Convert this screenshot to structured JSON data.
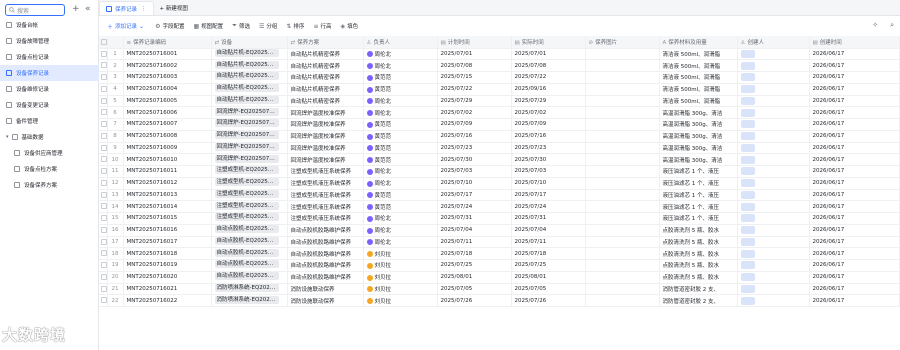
{
  "sidebar": {
    "search_placeholder": "搜索",
    "items": [
      {
        "label": "设备台帐",
        "active": false,
        "type": "page"
      },
      {
        "label": "设备故障管理",
        "active": false,
        "type": "page"
      },
      {
        "label": "设备点检记录",
        "active": false,
        "type": "page"
      },
      {
        "label": "设备保养记录",
        "active": true,
        "type": "page"
      },
      {
        "label": "设备维修记录",
        "active": false,
        "type": "page"
      },
      {
        "label": "设备变更记录",
        "active": false,
        "type": "page"
      },
      {
        "label": "备件管理",
        "active": false,
        "type": "page"
      },
      {
        "label": "基础数据",
        "active": false,
        "type": "folder"
      },
      {
        "label": "设备供应商管理",
        "active": false,
        "type": "sub"
      },
      {
        "label": "设备点检方案",
        "active": false,
        "type": "sub"
      },
      {
        "label": "设备保养方案",
        "active": false,
        "type": "sub"
      }
    ]
  },
  "tabs": {
    "active": "保养记录",
    "new": "+ 新建视图"
  },
  "toolbar": {
    "add": "添加记录",
    "fields": "字段配置",
    "view": "视图配置",
    "filter": "筛选",
    "group": "分组",
    "sort": "排序",
    "rowheight": "行高",
    "color": "填色"
  },
  "columns": [
    "保养记录编码",
    "设备",
    "保养方案",
    "负责人",
    "计划时间",
    "实际时间",
    "保养图片",
    "保养材料及用量",
    "创建人",
    "创建时间"
  ],
  "rows": [
    {
      "n": "1",
      "code": "MNT20250716001",
      "dev": "自动贴片机-EQ202507001",
      "plan": "自动贴片机精密保养",
      "owner": "周伦北",
      "oc": "#7b61ff",
      "pt": "2025/07/01",
      "at": "2025/07/01",
      "mat": "清洁液 500ml、润滑脂",
      "ct": "2026/06/17"
    },
    {
      "n": "2",
      "code": "MNT20250716002",
      "dev": "自动贴片机-EQ202507001",
      "plan": "自动贴片机精密保养",
      "owner": "周伦北",
      "oc": "#7b61ff",
      "pt": "2025/07/08",
      "at": "2025/07/08",
      "mat": "清洁液 500ml、润滑脂",
      "ct": "2026/06/17"
    },
    {
      "n": "3",
      "code": "MNT20250716003",
      "dev": "自动贴片机-EQ202507001",
      "plan": "自动贴片机精密保养",
      "owner": "黄范范",
      "oc": "#7b61ff",
      "pt": "2025/07/15",
      "at": "2025/07/22",
      "mat": "清洁液 500ml、润滑脂",
      "ct": "2026/06/17"
    },
    {
      "n": "4",
      "code": "MNT20250716004",
      "dev": "自动贴片机-EQ202507001",
      "plan": "自动贴片机精密保养",
      "owner": "黄范范",
      "oc": "#7b61ff",
      "pt": "2025/07/22",
      "at": "2025/09/16",
      "mat": "清洁液 500ml、润滑脂",
      "ct": "2026/06/17"
    },
    {
      "n": "5",
      "code": "MNT20250716005",
      "dev": "自动贴片机-EQ202507001",
      "plan": "自动贴片机精密保养",
      "owner": "周伦北",
      "oc": "#7b61ff",
      "pt": "2025/07/29",
      "at": "2025/07/29",
      "mat": "清洁液 500ml、润滑脂",
      "ct": "2026/06/17"
    },
    {
      "n": "6",
      "code": "MNT20250716006",
      "dev": "回流焊炉-EQ2025070002",
      "plan": "回流焊炉温度校准保养",
      "owner": "周伦北",
      "oc": "#7b61ff",
      "pt": "2025/07/02",
      "at": "2025/07/02",
      "mat": "高温润滑脂 300g、清洁",
      "ct": "2026/06/17"
    },
    {
      "n": "7",
      "code": "MNT20250716007",
      "dev": "回流焊炉-EQ2025070002",
      "plan": "回流焊炉温度校准保养",
      "owner": "黄范范",
      "oc": "#7b61ff",
      "pt": "2025/07/09",
      "at": "2025/07/09",
      "mat": "高温润滑脂 300g、清洁",
      "ct": "2026/06/17"
    },
    {
      "n": "8",
      "code": "MNT20250716008",
      "dev": "回流焊炉-EQ2025070002",
      "plan": "回流焊炉温度校准保养",
      "owner": "黄范范",
      "oc": "#7b61ff",
      "pt": "2025/07/16",
      "at": "2025/07/16",
      "mat": "高温润滑脂 300g、清洁",
      "ct": "2026/06/17"
    },
    {
      "n": "9",
      "code": "MNT20250716009",
      "dev": "回流焊炉-EQ2025070002",
      "plan": "回流焊炉温度校准保养",
      "owner": "黄范范",
      "oc": "#7b61ff",
      "pt": "2025/07/23",
      "at": "2025/07/23",
      "mat": "高温润滑脂 300g、清洁",
      "ct": "2026/06/17"
    },
    {
      "n": "10",
      "code": "MNT20250716010",
      "dev": "回流焊炉-EQ2025070002",
      "plan": "回流焊炉温度校准保养",
      "owner": "黄范范",
      "oc": "#7b61ff",
      "pt": "2025/07/30",
      "at": "2025/07/30",
      "mat": "高温润滑脂 300g、清洁",
      "ct": "2026/06/17"
    },
    {
      "n": "11",
      "code": "MNT20250716011",
      "dev": "注塑成型机-EQ202507003",
      "plan": "注塑成型机液压系统保养",
      "owner": "周伦北",
      "oc": "#7b61ff",
      "pt": "2025/07/03",
      "at": "2025/07/03",
      "mat": "液压油滤芯 1 个、液压",
      "ct": "2026/06/17"
    },
    {
      "n": "12",
      "code": "MNT20250716012",
      "dev": "注塑成型机-EQ202507003",
      "plan": "注塑成型机液压系统保养",
      "owner": "周伦北",
      "oc": "#7b61ff",
      "pt": "2025/07/10",
      "at": "2025/07/10",
      "mat": "液压油滤芯 1 个、液压",
      "ct": "2026/06/17"
    },
    {
      "n": "13",
      "code": "MNT20250716013",
      "dev": "注塑成型机-EQ202507003",
      "plan": "注塑成型机液压系统保养",
      "owner": "黄范范",
      "oc": "#7b61ff",
      "pt": "2025/07/17",
      "at": "2025/07/17",
      "mat": "液压油滤芯 1 个、液压",
      "ct": "2026/06/17"
    },
    {
      "n": "14",
      "code": "MNT20250716014",
      "dev": "注塑成型机-EQ202507003",
      "plan": "注塑成型机液压系统保养",
      "owner": "黄范范",
      "oc": "#7b61ff",
      "pt": "2025/07/24",
      "at": "2025/07/24",
      "mat": "液压油滤芯 1 个、液压",
      "ct": "2026/06/17"
    },
    {
      "n": "15",
      "code": "MNT20250716015",
      "dev": "注塑成型机-EQ202507003",
      "plan": "注塑成型机液压系统保养",
      "owner": "周伦北",
      "oc": "#7b61ff",
      "pt": "2025/07/31",
      "at": "2025/07/31",
      "mat": "液压油滤芯 1 个、液压",
      "ct": "2026/06/17"
    },
    {
      "n": "16",
      "code": "MNT20250716016",
      "dev": "自动点胶机-EQ202507004",
      "plan": "自动点胶机胶路维护保养",
      "owner": "周伦北",
      "oc": "#7b61ff",
      "pt": "2025/07/04",
      "at": "2025/07/04",
      "mat": "点胶清洗剂 5 瓶、胶水",
      "ct": "2026/06/17"
    },
    {
      "n": "17",
      "code": "MNT20250716017",
      "dev": "自动点胶机-EQ202507004",
      "plan": "自动点胶机胶路维护保养",
      "owner": "周伦北",
      "oc": "#7b61ff",
      "pt": "2025/07/11",
      "at": "2025/07/11",
      "mat": "点胶清洗剂 5 瓶、胶水",
      "ct": "2026/06/17"
    },
    {
      "n": "18",
      "code": "MNT20250716018",
      "dev": "自动点胶机-EQ202507004",
      "plan": "自动点胶机胶路维护保养",
      "owner": "刘贝拉",
      "oc": "#f5a623",
      "pt": "2025/07/18",
      "at": "2025/07/18",
      "mat": "点胶清洗剂 5 瓶、胶水",
      "ct": "2026/06/17"
    },
    {
      "n": "19",
      "code": "MNT20250716019",
      "dev": "自动点胶机-EQ202507004",
      "plan": "自动点胶机胶路维护保养",
      "owner": "刘贝拉",
      "oc": "#f5a623",
      "pt": "2025/07/25",
      "at": "2025/07/25",
      "mat": "点胶清洗剂 5 瓶、胶水",
      "ct": "2026/06/17"
    },
    {
      "n": "20",
      "code": "MNT20250716020",
      "dev": "自动点胶机-EQ202507004",
      "plan": "自动点胶机胶路维护保养",
      "owner": "刘贝拉",
      "oc": "#f5a623",
      "pt": "2025/08/01",
      "at": "2025/08/01",
      "mat": "点胶清洗剂 5 瓶、胶水",
      "ct": "2026/06/17"
    },
    {
      "n": "21",
      "code": "MNT20250716021",
      "dev": "消防喷淋系统-EQ202507005",
      "plan": "消防设施联动保养",
      "owner": "刘贝拉",
      "oc": "#f5a623",
      "pt": "2025/07/05",
      "at": "2025/07/05",
      "mat": "消防管道密封胶 2 支、",
      "ct": "2026/06/17"
    },
    {
      "n": "22",
      "code": "MNT20250716022",
      "dev": "消防喷淋系统-EQ202507005",
      "plan": "消防设施联动保养",
      "owner": "刘贝拉",
      "oc": "#f5a623",
      "pt": "2025/07/26",
      "at": "2025/07/26",
      "mat": "消防管道密封胶 2 支、",
      "ct": "2026/06/17"
    }
  ],
  "watermark": "大数跨境"
}
